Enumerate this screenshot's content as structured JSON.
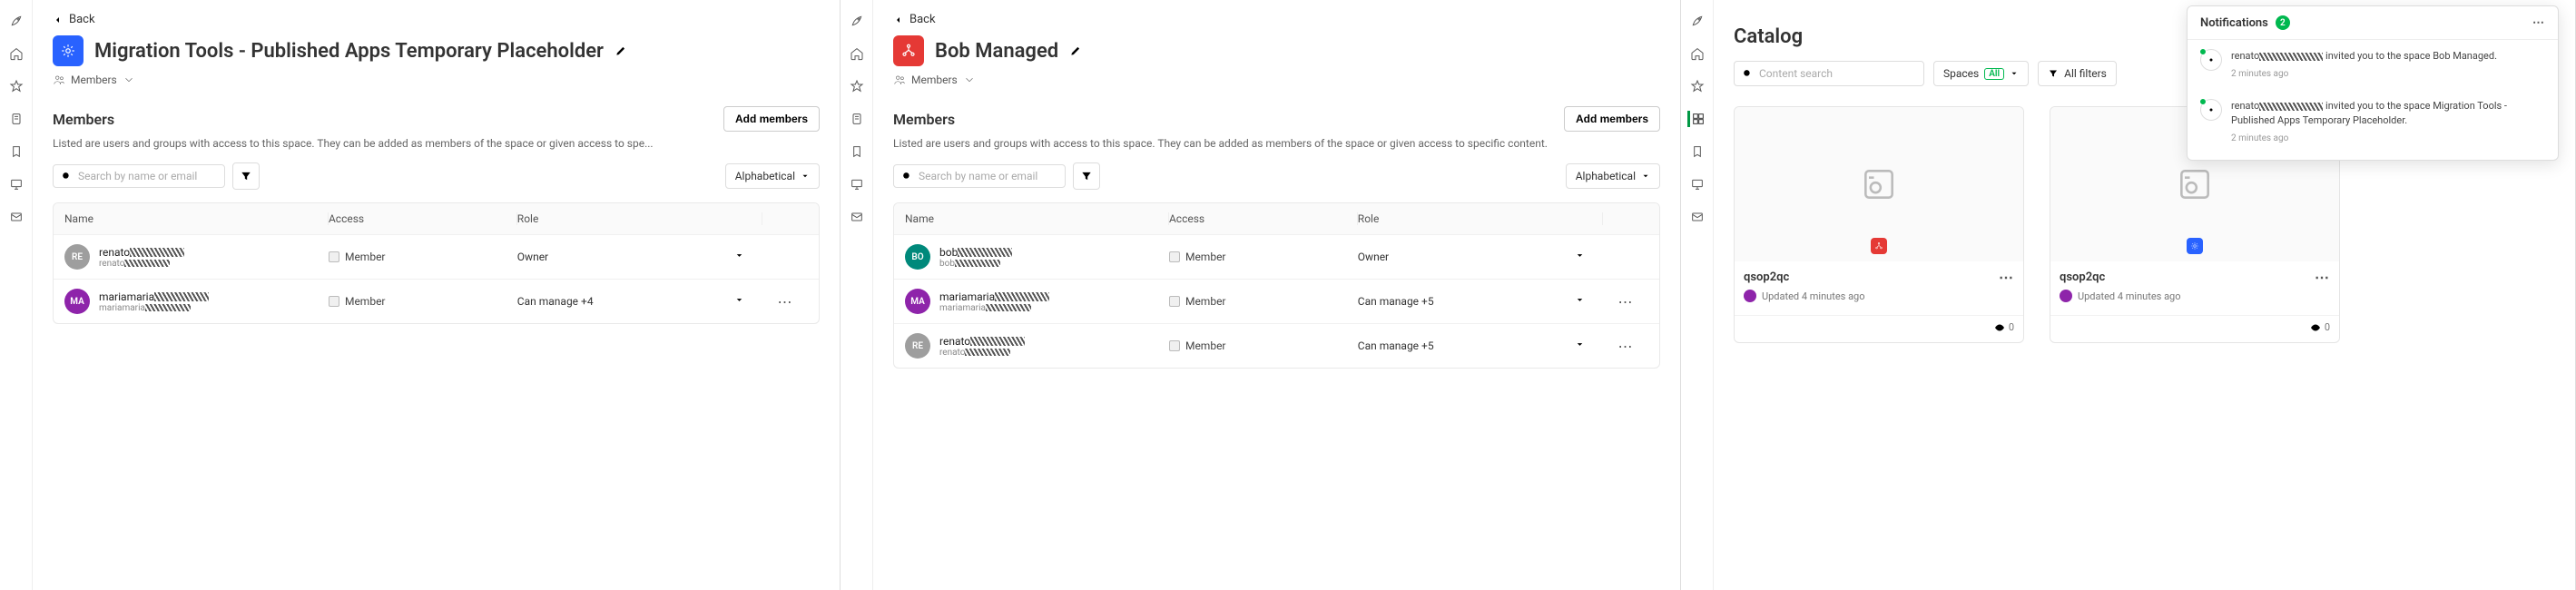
{
  "navIcons": [
    "rocket",
    "home",
    "star",
    "clipboard",
    "bookmark",
    "monitor",
    "mail"
  ],
  "navIconsCatalog": [
    "rocket",
    "home",
    "star",
    "grid",
    "bookmark",
    "monitor",
    "mail"
  ],
  "back": "Back",
  "panel1": {
    "title": "Migration Tools - Published Apps Temporary Placeholder",
    "iconColor": "blue",
    "membersLink": "Members",
    "sectionTitle": "Members",
    "addBtn": "Add members",
    "desc": "Listed are users and groups with access to this space. They can be added as members of the space or given access to spe...",
    "searchPlaceholder": "Search by name or email",
    "sort": "Alphabetical",
    "columns": [
      "Name",
      "Access",
      "Role",
      ""
    ],
    "rows": [
      {
        "avColor": "gr",
        "avInit": "RE",
        "name": "renato",
        "sub": "renato",
        "access": "Member",
        "role": "Owner",
        "roleChev": true,
        "more": false
      },
      {
        "avColor": "p",
        "avInit": "MA",
        "name": "mariamaria",
        "sub": "mariamaria",
        "access": "Member",
        "role": "Can manage +4",
        "roleChev": true,
        "more": true
      }
    ]
  },
  "panel2": {
    "title": "Bob Managed",
    "iconColor": "red",
    "membersLink": "Members",
    "sectionTitle": "Members",
    "addBtn": "Add members",
    "desc": "Listed are users and groups with access to this space. They can be added as members of the space or given access to specific content.",
    "searchPlaceholder": "Search by name or email",
    "sort": "Alphabetical",
    "columns": [
      "Name",
      "Access",
      "Role",
      ""
    ],
    "rows": [
      {
        "avColor": "g",
        "avInit": "BO",
        "name": "bob",
        "sub": "bob",
        "access": "Member",
        "role": "Owner",
        "roleChev": true,
        "more": false
      },
      {
        "avColor": "p",
        "avInit": "MA",
        "name": "mariamaria",
        "sub": "mariamaria",
        "access": "Member",
        "role": "Can manage +5",
        "roleChev": true,
        "more": true
      },
      {
        "avColor": "gr",
        "avInit": "RE",
        "name": "renato",
        "sub": "renato",
        "access": "Member",
        "role": "Can manage +5",
        "roleChev": true,
        "more": true
      }
    ]
  },
  "panel3": {
    "title": "Catalog",
    "searchPlaceholder": "Content search",
    "spacesLabel": "Spaces",
    "spacesBadge": "All",
    "filtersLabel": "All filters",
    "cards": [
      {
        "title": "qsop2qc",
        "meta": "Updated 4 minutes ago",
        "views": "0",
        "mini": "red"
      },
      {
        "title": "qsop2qc",
        "meta": "Updated 4 minutes ago",
        "views": "0",
        "mini": "blue"
      }
    ],
    "notif": {
      "title": "Notifications",
      "count": "2",
      "items": [
        {
          "text1": "renato",
          "text2": "invited you to the space Bob Managed.",
          "time": "2 minutes ago"
        },
        {
          "text1": "renato",
          "text2": "invited you to the space Migration Tools - Published Apps Temporary Placeholder.",
          "time": "2 minutes ago"
        }
      ]
    }
  }
}
